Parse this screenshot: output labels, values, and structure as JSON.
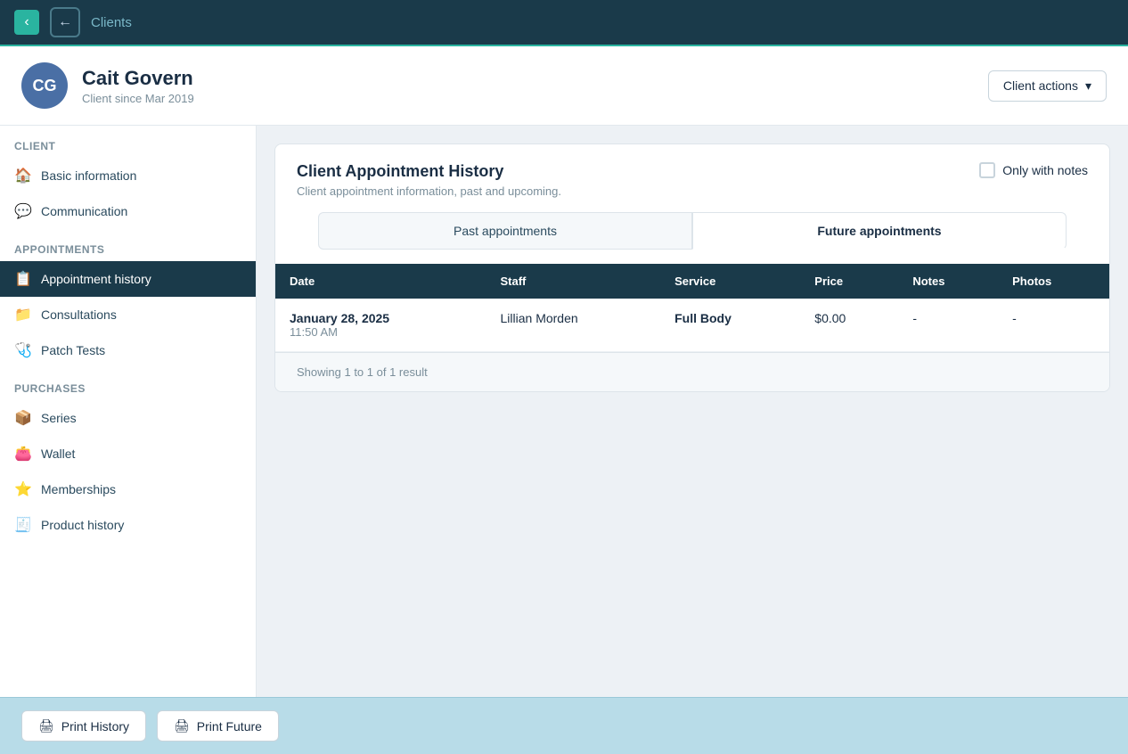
{
  "topNav": {
    "title": "Clients"
  },
  "clientHeader": {
    "avatarInitials": "CG",
    "name": "Cait Govern",
    "since": "Client since Mar 2019",
    "actionsLabel": "Client actions",
    "actionsIcon": "▾"
  },
  "sidebar": {
    "sections": [
      {
        "label": "Client",
        "items": [
          {
            "id": "basic-information",
            "icon": "🏠",
            "label": "Basic information",
            "active": false
          },
          {
            "id": "communication",
            "icon": "💬",
            "label": "Communication",
            "active": false
          }
        ]
      },
      {
        "label": "Appointments",
        "items": [
          {
            "id": "appointment-history",
            "icon": "📋",
            "label": "Appointment history",
            "active": true
          },
          {
            "id": "consultations",
            "icon": "📁",
            "label": "Consultations",
            "active": false
          },
          {
            "id": "patch-tests",
            "icon": "🩺",
            "label": "Patch Tests",
            "active": false
          }
        ]
      },
      {
        "label": "Purchases",
        "items": [
          {
            "id": "series",
            "icon": "📦",
            "label": "Series",
            "active": false
          },
          {
            "id": "wallet",
            "icon": "👛",
            "label": "Wallet",
            "active": false
          },
          {
            "id": "memberships",
            "icon": "⭐",
            "label": "Memberships",
            "active": false
          },
          {
            "id": "product-history",
            "icon": "🧾",
            "label": "Product history",
            "active": false
          }
        ]
      }
    ]
  },
  "mainCard": {
    "title": "Client Appointment History",
    "subtitle": "Client appointment information, past and upcoming.",
    "onlyNotesLabel": "Only with notes",
    "tabs": [
      {
        "id": "past",
        "label": "Past appointments",
        "active": false
      },
      {
        "id": "future",
        "label": "Future appointments",
        "active": true
      }
    ],
    "table": {
      "columns": [
        {
          "id": "date",
          "label": "Date"
        },
        {
          "id": "staff",
          "label": "Staff"
        },
        {
          "id": "service",
          "label": "Service"
        },
        {
          "id": "price",
          "label": "Price"
        },
        {
          "id": "notes",
          "label": "Notes"
        },
        {
          "id": "photos",
          "label": "Photos"
        }
      ],
      "rows": [
        {
          "date": "January 28, 2025",
          "time": "11:50 AM",
          "staff": "Lillian Morden",
          "service": "Full Body",
          "price": "$0.00",
          "notes": "-",
          "photos": "-"
        }
      ]
    },
    "footer": "Showing 1 to 1 of 1 result"
  },
  "bottomBar": {
    "printHistoryLabel": "Print History",
    "printFutureLabel": "Print Future"
  }
}
